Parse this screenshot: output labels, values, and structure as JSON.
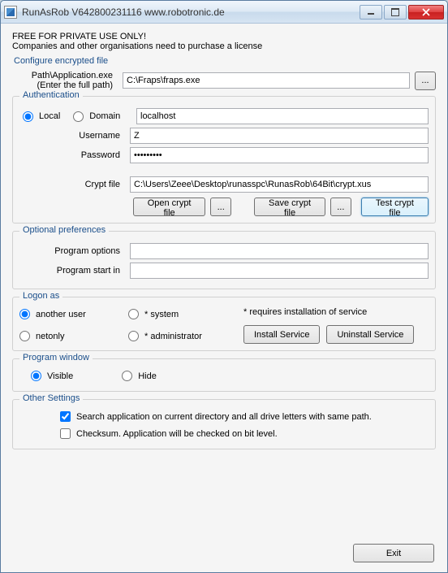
{
  "window": {
    "title": "RunAsRob V642800231116 www.robotronic.de"
  },
  "header": {
    "free_line": "FREE FOR PRIVATE USE ONLY!",
    "license_line": "Companies and other organisations need to purchase a license"
  },
  "configure": {
    "section_label": "Configure encrypted file",
    "path_label_line1": "Path\\Application.exe",
    "path_label_line2": "(Enter the full path)",
    "path_value": "C:\\Fraps\\fraps.exe",
    "browse": "..."
  },
  "auth": {
    "legend": "Authentication",
    "local_label": "Local",
    "domain_label": "Domain",
    "mode": "local",
    "host_value": "localhost",
    "username_label": "Username",
    "username_value": "Z",
    "password_label": "Password",
    "password_value": "•••••••••",
    "cryptfile_label": "Crypt file",
    "cryptfile_value": "C:\\Users\\Zeee\\Desktop\\runasspc\\RunasRob\\64Bit\\crypt.xus",
    "open_label": "Open crypt file",
    "open_ellipsis": "...",
    "save_label": "Save crypt file",
    "save_ellipsis": "...",
    "test_label": "Test crypt file"
  },
  "optional": {
    "legend": "Optional preferences",
    "program_options_label": "Program options",
    "program_options_value": "",
    "program_startin_label": "Program start in",
    "program_startin_value": ""
  },
  "logon": {
    "legend": "Logon as",
    "another_user": "another user",
    "netonly": "netonly",
    "system": "* system",
    "administrator": "* administrator",
    "selected": "another_user",
    "requires_note": "* requires installation of service",
    "install_label": "Install Service",
    "uninstall_label": "Uninstall Service"
  },
  "progwin": {
    "legend": "Program window",
    "visible": "Visible",
    "hide": "Hide",
    "selected": "visible"
  },
  "other": {
    "legend": "Other Settings",
    "search_checked": true,
    "search_label": "Search application on current directory and all drive letters with same path.",
    "checksum_checked": false,
    "checksum_label": "Checksum. Application will be checked on bit level."
  },
  "footer": {
    "exit": "Exit"
  }
}
